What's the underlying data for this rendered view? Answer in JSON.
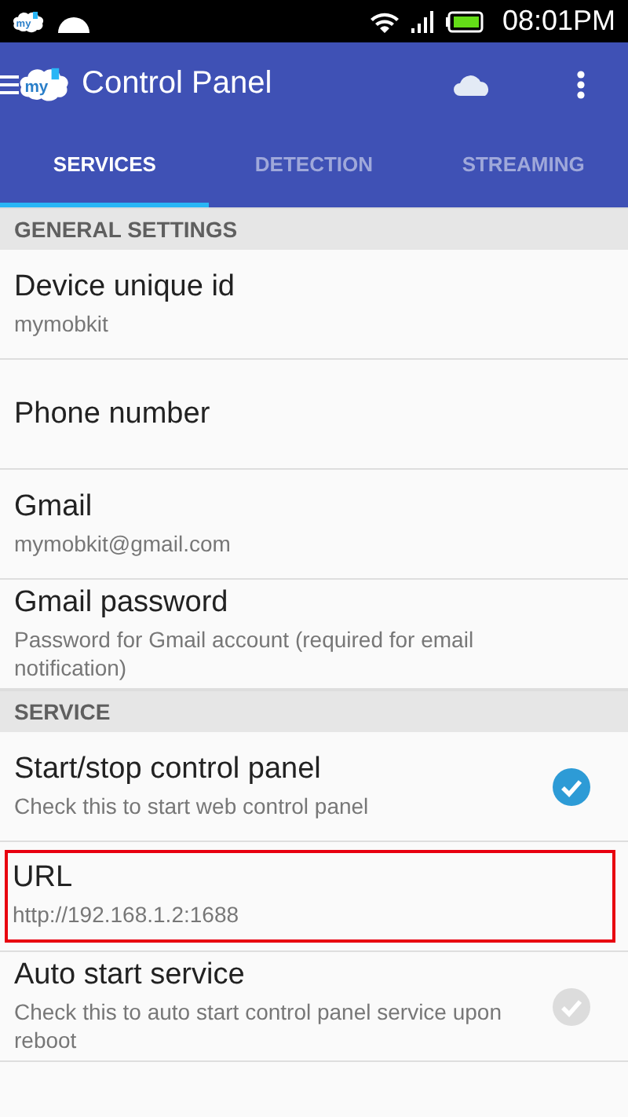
{
  "status_bar": {
    "notification_logo": "my",
    "time": "08:01PM"
  },
  "app_bar": {
    "logo": "my",
    "title": "Control Panel"
  },
  "tabs": [
    {
      "label": "SERVICES",
      "selected": true
    },
    {
      "label": "DETECTION",
      "selected": false
    },
    {
      "label": "STREAMING",
      "selected": false
    }
  ],
  "sections": [
    {
      "title": "GENERAL SETTINGS",
      "items": [
        {
          "kind": "text",
          "title": "Device unique id",
          "summary": "mymobkit",
          "highlighted": false
        },
        {
          "kind": "text",
          "title": "Phone number",
          "highlighted": false
        },
        {
          "kind": "text",
          "title": "Gmail",
          "summary": "mymobkit@gmail.com",
          "highlighted": false
        },
        {
          "kind": "text",
          "title": "Gmail password",
          "summary": "Password for Gmail account (required for email notification)",
          "highlighted": false
        }
      ]
    },
    {
      "title": "SERVICE",
      "items": [
        {
          "kind": "check",
          "title": "Start/stop control panel",
          "summary": "Check this to start web control panel",
          "checked": true,
          "highlighted": false
        },
        {
          "kind": "text",
          "title": "URL",
          "summary": "http://192.168.1.2:1688",
          "highlighted": true
        },
        {
          "kind": "check",
          "title": "Auto start service",
          "summary": "Check this to auto start control panel service upon reboot",
          "checked": false,
          "highlighted": false
        }
      ]
    }
  ]
}
